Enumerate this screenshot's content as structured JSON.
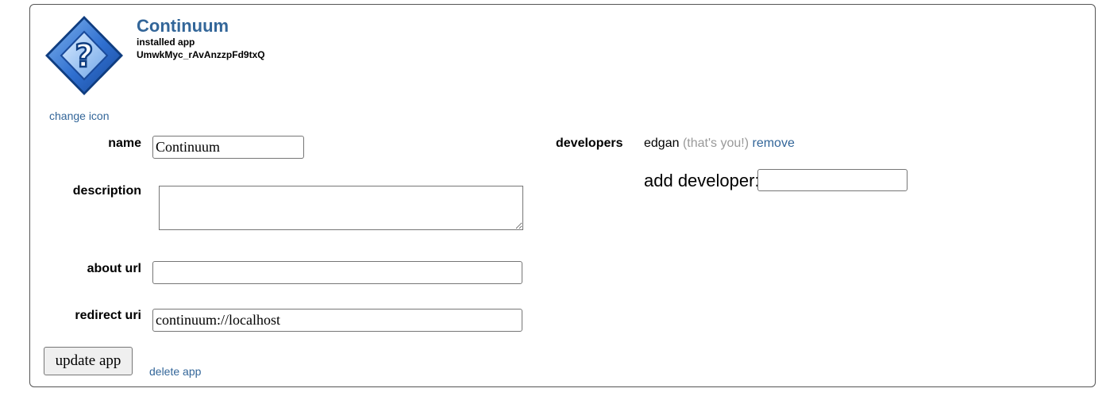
{
  "app": {
    "title": "Continuum",
    "type_label": "installed app",
    "client_id": "UmwkMyc_rAvAnzzpFd9txQ",
    "change_icon_label": "change icon",
    "icon": "question-mark-diamond-icon",
    "accent_color": "#336699"
  },
  "form": {
    "name_label": "name",
    "name_value": "Continuum",
    "description_label": "description",
    "description_value": "",
    "about_url_label": "about url",
    "about_url_value": "",
    "redirect_uri_label": "redirect uri",
    "redirect_uri_value": "continuum://localhost",
    "update_button_label": "update app",
    "delete_link_label": "delete app"
  },
  "developers": {
    "label": "developers",
    "list": [
      {
        "username": "edgan",
        "note": "(that's you!)",
        "remove_label": "remove"
      }
    ],
    "add_label": "add developer:",
    "add_value": ""
  }
}
